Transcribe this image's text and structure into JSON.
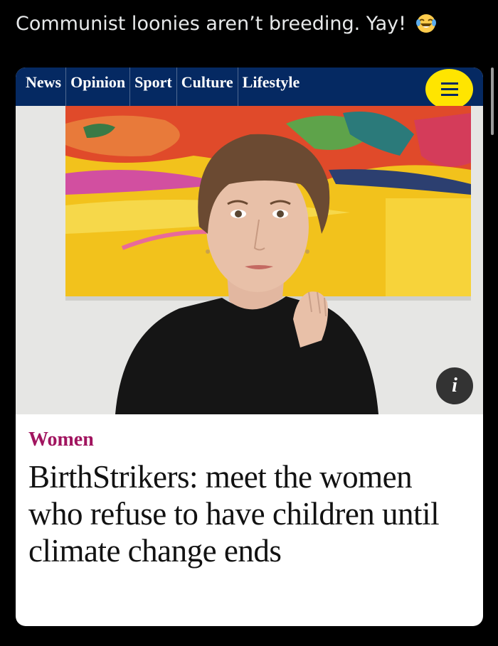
{
  "tweet": {
    "text": "Communist loonies aren’t breeding. Yay!",
    "emoji": "face-with-tears-of-joy"
  },
  "article": {
    "nav": {
      "items": [
        "News",
        "Opinion",
        "Sport",
        "Culture",
        "Lifestyle"
      ],
      "background_color": "#052962",
      "menu_icon": "hamburger-icon",
      "menu_color": "#ffe500"
    },
    "info_button_label": "i",
    "section": "Women",
    "section_color": "#a1145f",
    "headline": "BirthStrikers: meet the women who refuse to have children until climate change ends"
  }
}
